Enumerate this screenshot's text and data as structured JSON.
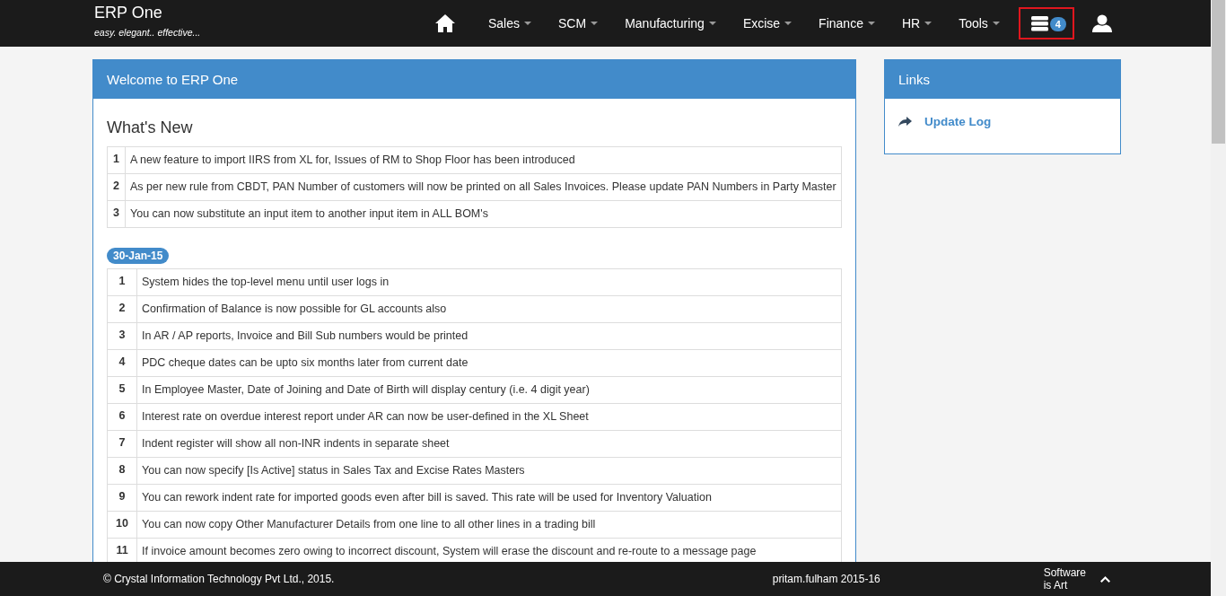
{
  "brand": {
    "title": "ERP One",
    "tagline": "easy. elegant.. effective..."
  },
  "nav": {
    "menus": [
      {
        "label": "Sales"
      },
      {
        "label": "SCM"
      },
      {
        "label": "Manufacturing"
      },
      {
        "label": "Excise"
      },
      {
        "label": "Finance"
      },
      {
        "label": "HR"
      },
      {
        "label": "Tools"
      }
    ],
    "notifications": {
      "badge": "4",
      "highlighted": true
    }
  },
  "main_panel": {
    "title": "Welcome to ERP One",
    "heading": "What's New",
    "latest": [
      {
        "number": "1",
        "text": "A new feature to import IIRS from XL for, Issues of RM to Shop Floor has been introduced"
      },
      {
        "number": "2",
        "text": "As per new rule from CBDT, PAN Number of customers will now be printed on all Sales Invoices. Please update PAN Numbers in Party Master"
      },
      {
        "number": "3",
        "text": "You can now substitute an input item to another input item in ALL BOM's"
      }
    ],
    "releases": [
      {
        "date": "30-Jan-15",
        "items": [
          {
            "number": "1",
            "text": "System hides the top-level menu until user logs in"
          },
          {
            "number": "2",
            "text": "Confirmation of Balance is now possible for GL accounts also"
          },
          {
            "number": "3",
            "text": "In AR / AP reports, Invoice and Bill Sub numbers would be printed"
          },
          {
            "number": "4",
            "text": "PDC cheque dates can be upto six months later from current date"
          },
          {
            "number": "5",
            "text": "In Employee Master, Date of Joining and Date of Birth will display century (i.e. 4 digit year)"
          },
          {
            "number": "6",
            "text": "Interest rate on overdue interest report under AR can now be user-defined in the XL Sheet"
          },
          {
            "number": "7",
            "text": "Indent register will show all non-INR indents in separate sheet"
          },
          {
            "number": "8",
            "text": "You can now specify [Is Active] status in Sales Tax and Excise Rates Masters"
          },
          {
            "number": "9",
            "text": "You can rework indent rate for imported goods even after bill is saved. This rate will be used for Inventory Valuation"
          },
          {
            "number": "10",
            "text": "You can now copy Other Manufacturer Details from one line to all other lines in a trading bill"
          },
          {
            "number": "11",
            "text": "If invoice amount becomes zero owing to incorrect discount, System will erase the discount and re-route to a message page"
          }
        ]
      }
    ]
  },
  "links_panel": {
    "title": "Links",
    "links": [
      {
        "label": "Update Log"
      }
    ]
  },
  "footer": {
    "copyright": "© Crystal Information Technology Pvt Ltd., 2015.",
    "user": "pritam.fulham 2015-16",
    "motto": "Software is Art"
  }
}
